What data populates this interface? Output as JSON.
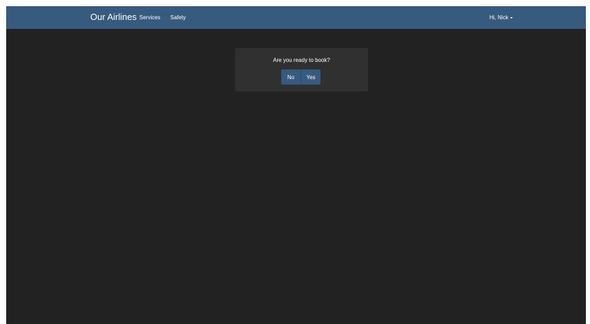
{
  "navbar": {
    "brand": "Our Airlines",
    "links": [
      {
        "label": "Services"
      },
      {
        "label": "Safety"
      }
    ],
    "user_menu": "Hi, Nick"
  },
  "dialog": {
    "message": "Are you ready to book?",
    "buttons": {
      "no_label": "No",
      "yes_label": "Yes"
    }
  },
  "colors": {
    "navbar_bg": "#375a7f",
    "page_bg": "#222222",
    "dialog_bg": "#303030",
    "button_bg": "#375a7f",
    "text": "#ffffff"
  }
}
